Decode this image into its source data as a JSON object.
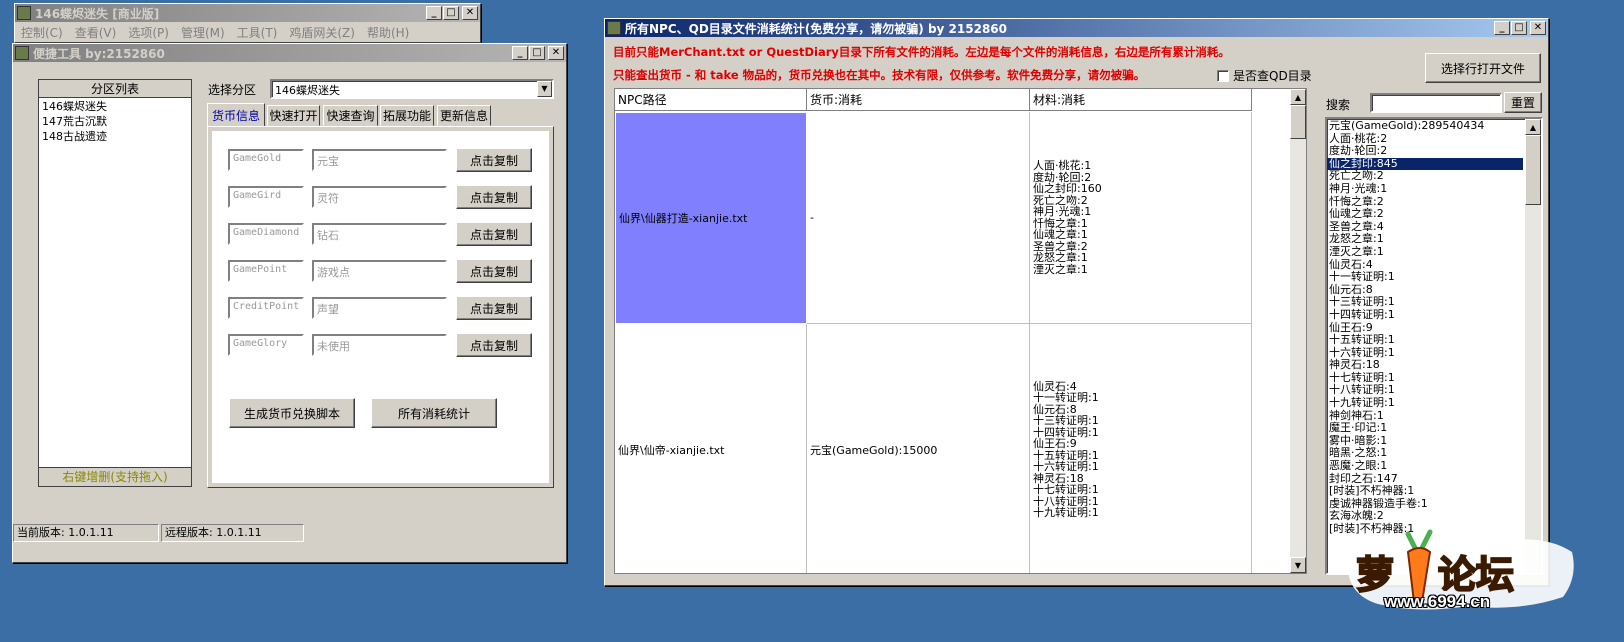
{
  "main_window": {
    "title": "146蝶烬迷失 [商业版]",
    "menu": [
      "控制(C)",
      "查看(V)",
      "选项(P)",
      "管理(M)",
      "工具(T)",
      "鸡盾网关(Z)",
      "帮助(H)"
    ]
  },
  "tools_window": {
    "title": "便捷工具  by:2152860",
    "partition_list": {
      "header": "分区列表",
      "items": [
        "146蝶烬迷失",
        "147荒古沉默",
        "148古战遗迹"
      ],
      "footer": "右键增删(支持拖入)"
    },
    "select_label": "选择分区",
    "select_value": "146蝶烬迷失",
    "tabs": [
      "货币信息",
      "快速打开",
      "快速查询",
      "拓展功能",
      "更新信息"
    ],
    "currencies": [
      {
        "code": "GameGold",
        "name": "元宝",
        "button": "点击复制"
      },
      {
        "code": "GameGird",
        "name": "灵符",
        "button": "点击复制"
      },
      {
        "code": "GameDiamond",
        "name": "钻石",
        "button": "点击复制"
      },
      {
        "code": "GamePoint",
        "name": "游戏点",
        "button": "点击复制"
      },
      {
        "code": "CreditPoint",
        "name": "声望",
        "button": "点击复制"
      },
      {
        "code": "GameGlory",
        "name": "未使用",
        "button": "点击复制"
      }
    ],
    "gen_button": "生成货币兑换脚本",
    "stats_button": "所有消耗统计",
    "status": {
      "current": "当前版本: 1.0.1.11",
      "remote": "远程版本: 1.0.1.11"
    }
  },
  "stats_window": {
    "title": "所有NPC、QD目录文件消耗统计(免费分享，请勿被骗)    by 2152860",
    "notice1": "目前只能MerChant.txt or QuestDiary目录下所有文件的消耗。左边是每个文件的消耗信息，右边是所有累计消耗。",
    "notice2": "只能查出货币 - 和 take 物品的，货币兑换也在其中。技术有限，仅供参考。软件免费分享，请勿被骗。",
    "checkbox_label": "是否查QD目录",
    "open_button": "选择行打开文件",
    "search_label": "搜索",
    "search_value": "",
    "reset_button": "重置",
    "columns": [
      "NPC路径",
      "货币:消耗",
      "材料:消耗"
    ],
    "rows": [
      {
        "path": "仙界\\仙器打造-xianjie.txt",
        "currency": "-",
        "materials": "人面·桃花:1\n度劫·轮回:2\n仙之封印:160\n死亡之吻:2\n神月·光魂:1\n忏悔之章:1\n仙魂之章:1\n圣兽之章:2\n龙怒之章:1\n湮灭之章:1"
      },
      {
        "path": "仙界\\仙帝-xianjie.txt",
        "currency": "元宝(GameGold):15000",
        "materials": "仙灵石:4\n十一转证明:1\n仙元石:8\n十三转证明:1\n十四转证明:1\n仙王石:9\n十五转证明:1\n十六转证明:1\n神灵石:18\n十七转证明:1\n十八转证明:1\n十九转证明:1"
      }
    ],
    "totals": [
      "元宝(GameGold):289540434",
      "人面·桃花:2",
      "度劫·轮回:2",
      "仙之封印:845",
      "死亡之吻:2",
      "神月·光魂:1",
      "忏悔之章:2",
      "仙魂之章:2",
      "圣兽之章:4",
      "龙怒之章:1",
      "湮灭之章:1",
      "仙灵石:4",
      "十一转证明:1",
      "仙元石:8",
      "十三转证明:1",
      "十四转证明:1",
      "仙王石:9",
      "十五转证明:1",
      "十六转证明:1",
      "神灵石:18",
      "十七转证明:1",
      "十八转证明:1",
      "十九转证明:1",
      "神剑神石:1",
      "魔王·印记:1",
      "雾中·暗影:1",
      "暗黑·之怒:1",
      "恶魔·之眼:1",
      "封印之石:147",
      "[时装]不朽神器:1",
      "虔诚神器锻造手卷:1",
      "玄海冰魄:2",
      "[时装]不朽神器:1"
    ],
    "selected_total_index": 3
  },
  "watermark": {
    "logo": "萝卜论坛",
    "url": "www.6994.cn"
  },
  "colors": {
    "desktop": "#3a6ea5",
    "selected_cell": "#8080ff",
    "notice": "#e00000",
    "list_selection": "#0a246a"
  }
}
